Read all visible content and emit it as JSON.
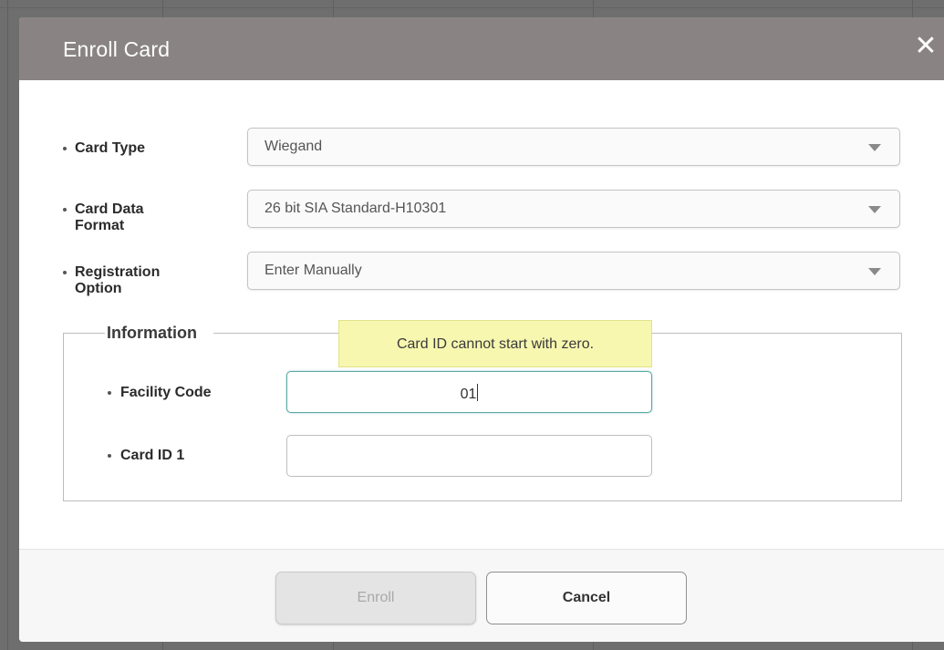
{
  "dialog": {
    "title": "Enroll Card",
    "close_icon": "close-icon"
  },
  "form": {
    "card_type": {
      "label": "Card Type",
      "value": "Wiegand"
    },
    "card_data_format": {
      "label_line1": "Card Data",
      "label_line2": "Format",
      "value": "26 bit SIA Standard-H10301"
    },
    "registration_option": {
      "label_line1": "Registration",
      "label_line2": "Option",
      "value": "Enter Manually"
    }
  },
  "information": {
    "legend": "Information",
    "tooltip": "Card ID cannot start with zero.",
    "facility_code": {
      "label": "Facility Code",
      "value": "01"
    },
    "card_id_1": {
      "label": "Card ID 1",
      "value": ""
    }
  },
  "buttons": {
    "enroll": "Enroll",
    "cancel": "Cancel"
  },
  "colors": {
    "header": "#8a8383",
    "tooltip_bg": "#f7f7b0",
    "focus_border": "#5aa8a4"
  }
}
